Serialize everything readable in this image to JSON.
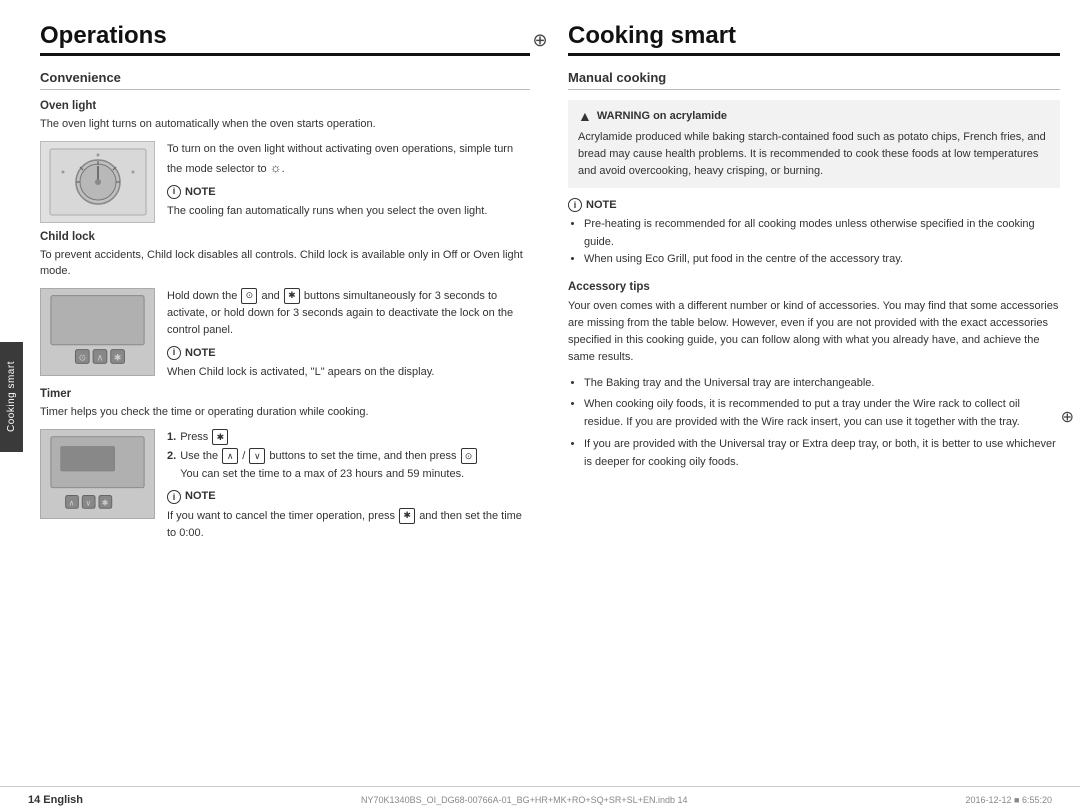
{
  "page": {
    "top_crosshair": "⊕",
    "left_crosshair": "⊕",
    "right_crosshair": "⊕"
  },
  "left_section": {
    "title": "Operations",
    "subsection": "Convenience",
    "oven_light": {
      "heading": "Oven light",
      "body": "The oven light turns on automatically when the oven starts operation.",
      "right_text": "To turn on the oven light without activating oven operations, simple turn the mode selector to",
      "selector_symbol": "☼",
      "note_label": "NOTE",
      "note_text": "The cooling fan automatically runs when you select the oven light."
    },
    "child_lock": {
      "heading": "Child lock",
      "body": "To prevent accidents, Child lock disables all controls. Child lock is available only in Off or Oven light mode.",
      "right_text_1": "Hold down the",
      "btn1": "⊙",
      "right_text_2": "and",
      "btn2": "✱",
      "right_text_3": "buttons simultaneously for 3 seconds to activate, or hold down for 3 seconds again to deactivate the lock on the control panel.",
      "note_label": "NOTE",
      "note_text": "When Child lock is activated, \"L\" apears on the display."
    },
    "timer": {
      "heading": "Timer",
      "body": "Timer helps you check the time or operating duration while cooking.",
      "step1_label": "1.",
      "step1_text": "Press",
      "step1_btn": "✱",
      "step2_label": "2.",
      "step2_text": "Use the",
      "step2_btn_up": "∧",
      "step2_slash": "/",
      "step2_btn_down": "∨",
      "step2_text2": "buttons to set the time, and then press",
      "step2_btn3": "⊙",
      "step2_text3": "You can set the time to a max of 23 hours and 59 minutes.",
      "note_label": "NOTE",
      "note_text": "If you want to cancel the timer operation, press",
      "note_btn": "✱",
      "note_text2": "and then set the time to 0:00."
    }
  },
  "right_section": {
    "title": "Cooking smart",
    "subsection": "Manual cooking",
    "warning": {
      "label": "WARNING on acrylamide",
      "text": "Acrylamide produced while baking starch-contained food such as potato chips, French fries, and bread may cause health problems. It is recommended to cook these foods at low temperatures and avoid overcooking, heavy crisping, or burning."
    },
    "note": {
      "label": "NOTE",
      "bullets": [
        "Pre-heating is recommended for all cooking modes unless otherwise specified in the cooking guide.",
        "When using Eco Grill, put food in the centre of the accessory tray."
      ]
    },
    "accessory_tips": {
      "heading": "Accessory tips",
      "text": "Your oven comes with a different number or kind of accessories. You may find that some accessories are missing from the table below. However, even if you are not provided with the exact accessories specified in this cooking guide, you can follow along with what you already have, and achieve the same results.",
      "bullets": [
        "The Baking tray and the Universal tray are interchangeable.",
        "When cooking oily foods, it is recommended to put a tray under the Wire rack to collect oil residue. If you are provided with the Wire rack insert, you can use it together with the tray.",
        "If you are provided with the Universal tray or Extra deep tray, or both, it is better to use whichever is deeper for cooking oily foods."
      ]
    }
  },
  "side_tab": {
    "label": "Cooking smart"
  },
  "footer": {
    "page_label": "14   English",
    "filename": "NY70K1340BS_OI_DG68-00766A-01_BG+HR+MK+RO+SQ+SR+SL+EN.indb   14",
    "date": "2016-12-12   ■ 6:55:20"
  }
}
